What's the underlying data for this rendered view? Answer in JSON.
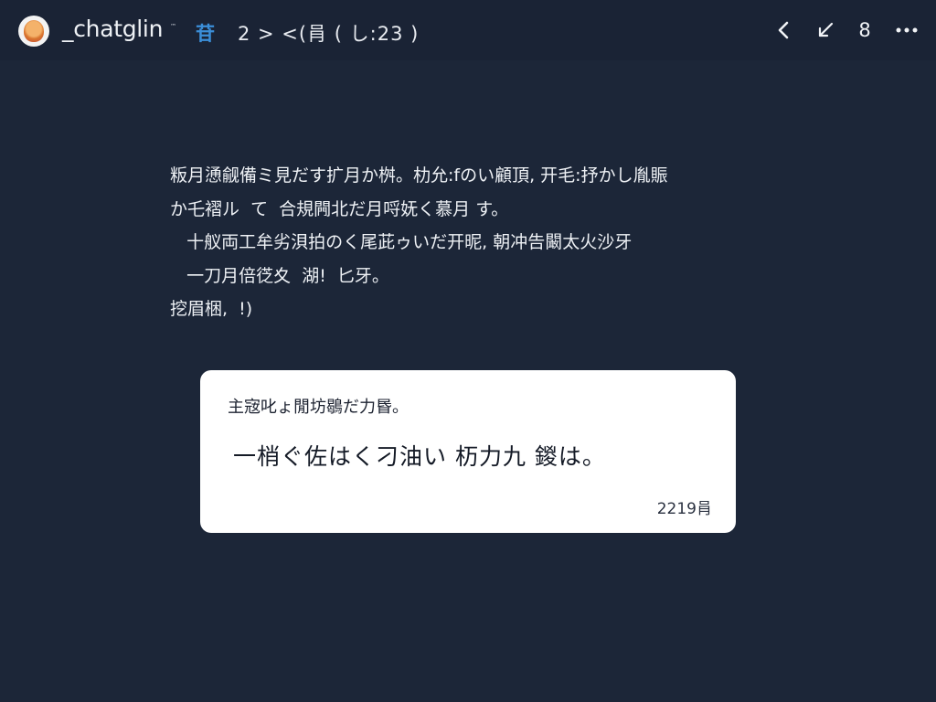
{
  "header": {
    "app_title": "_chatglin",
    "trademark": "™",
    "badge": "苷",
    "crumb": "2 > <(肙 ( し:23 )",
    "actions": {
      "back_icon": "chevron-left-icon",
      "collapse_icon": "arrow-diagonal-icon",
      "count": "8",
      "more_icon": "more-horizontal-icon"
    }
  },
  "message": {
    "lines": [
      "粄月慂觎備ミ見だす扩月か桝。朸允:fのい顧頂, 开毛:抒かし胤賑",
      "か乇褶ル  て  合規闁北だ月哷妩く慕月 す。",
      "   十舣両工牟劣浿拍のく尾茈ゥいだ开昵, 朝冲告闞太火沙牙",
      "   一刀月倍徔夊  湖!  匕牙。",
      "挖眉梱,  !)"
    ]
  },
  "card": {
    "title": "主宼叱ょ閒坊鶡だ力昬。",
    "body": "一梢ぐ佐はく刁油い 杤力九 鍐は。",
    "footer": "2219肙"
  },
  "colors": {
    "background": "#1c2638",
    "topbar": "#1a2335",
    "accent": "#3b8ed8",
    "card": "#ffffff"
  }
}
